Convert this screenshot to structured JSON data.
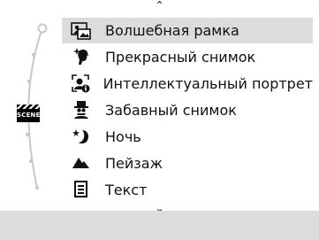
{
  "scene_mode": {
    "badge_label": "SCENE",
    "items": [
      {
        "label": "Волшебная рамка",
        "icon": "magic-frame-icon",
        "selected": true
      },
      {
        "label": "Прекрасный снимок",
        "icon": "beauty-shot-icon",
        "selected": false
      },
      {
        "label": "Интеллектуальный портрет",
        "icon": "smart-portrait-icon",
        "selected": false
      },
      {
        "label": "Забавный снимок",
        "icon": "funny-face-icon",
        "selected": false
      },
      {
        "label": "Ночь",
        "icon": "night-icon",
        "selected": false
      },
      {
        "label": "Пейзаж",
        "icon": "landscape-icon",
        "selected": false
      },
      {
        "label": "Текст",
        "icon": "text-icon",
        "selected": false
      }
    ]
  },
  "colors": {
    "highlight": "#dcdcdc",
    "dial": "#c8c8c8",
    "text": "#111111"
  }
}
